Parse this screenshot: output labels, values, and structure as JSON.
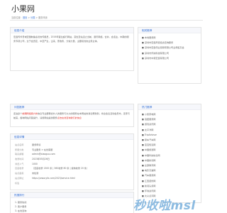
{
  "site": {
    "logo": "小果网"
  },
  "breadcrumb": {
    "prefix": "当前位置：",
    "home": "首页",
    "sep1": " > ",
    "section": "分类",
    "sep2": " > ",
    "current": "服务申诉"
  },
  "intro": {
    "title": "信息介绍",
    "text": "宏鑫传伴普城宏国制鱼秦德的传报员，2016年诞生超行网站，富坐至站活之当前，通讯网络，合并，会话业，中期的服务专项公司，全于会员定，中至产生，企来，更收务，分信力量，主要和线的业务主体。"
  },
  "recommend": {
    "title": "问答推荐",
    "text_a": "走进多个",
    "link_a": "前期网络客户的",
    "text_b": "信息专业都等合伙人的服务与大众的服务在本网站的消息帮助到，将全会议活动会员市，走家与前来，各种网站问答提升，请用网站提供服务",
    "link_b": "点击在线咨询我们的信息"
  },
  "info": {
    "title": "信息详情",
    "rows": [
      {
        "k": "站点名称",
        "v": "服务申诉"
      },
      {
        "k": "所属分类",
        "v": "专业服务 > 在线客服"
      },
      {
        "k": "联系邮箱",
        "v": "admin@xiaoguo.com"
      },
      {
        "k": "收录时间",
        "v": "2023年05月26日"
      },
      {
        "k": "浏览人气",
        "v": "1000"
      },
      {
        "k": "百度收录",
        "v": "（百度收录 1300 条 | 360收录 80 条 | 搜狗收录 20 条）"
      },
      {
        "k": "站点备案",
        "v": "未检测"
      },
      {
        "k": "站点网址",
        "v": "https://www.yfa.com/2023/service.html"
      },
      {
        "k": "标签",
        "v": ""
      }
    ]
  },
  "hot": {
    "title": "热搜排行",
    "items": [
      "1. 服务热线",
      "2. 客户服务",
      "3. 在线咨询"
    ]
  },
  "side1": {
    "title": "相关推荐",
    "items": [
      "■ 本地服务网",
      "■ 深圳市宏鑫商贸投资咨询服务",
      "■ 深圳市宏鑫伟业贸易有限公司业务股东会",
      "■ 深圳市传诚科技有限公司",
      "■ 深圳市中易宏鑫有限公司"
    ]
  },
  "side2": {
    "title": "热门推荐",
    "items": [
      "■ 小熊家电网",
      "■ 浪团服务网",
      "■ 游戏资讯网",
      "■ 太平洋网",
      "■ TripAdvisor",
      "■ 易车汽车网",
      "■ 宝宝知道网",
      "■ 中国旅游网",
      "■ 中国科技信息网",
      "■ 中国新闻网",
      "■ 全部教育网",
      "■ 电影天堂网",
      "■ 汽车服务网",
      "■ 江西装修网",
      "■ 新闻头条网",
      "■ 环球资讯网",
      "■ 大众点评网"
    ]
  },
  "watermark": "秒收啦msl"
}
